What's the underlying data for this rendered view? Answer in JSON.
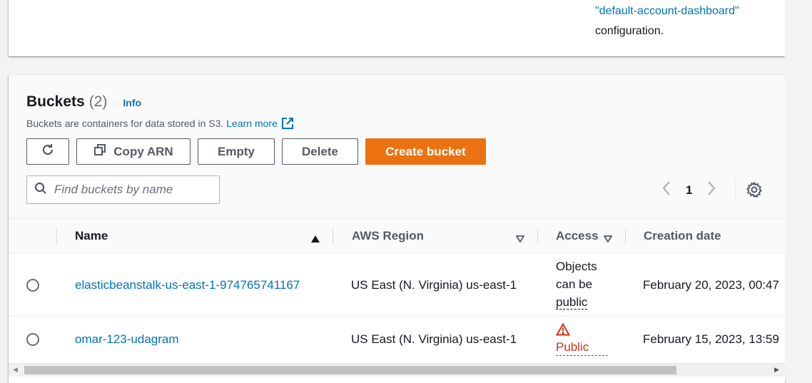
{
  "top_panel": {
    "config_name": "\"default-account-dashboard\"",
    "config_suffix": "configuration."
  },
  "buckets": {
    "title": "Buckets",
    "count": "(2)",
    "info_label": "Info",
    "description": "Buckets are containers for data stored in S3.",
    "learn_more": "Learn more",
    "toolbar": {
      "copy_arn_label": "Copy ARN",
      "empty_label": "Empty",
      "delete_label": "Delete",
      "create_label": "Create bucket"
    },
    "search": {
      "placeholder": "Find buckets by name",
      "value": ""
    },
    "pagination": {
      "current_page": "1"
    },
    "columns": {
      "name": "Name",
      "region": "AWS Region",
      "access": "Access",
      "created": "Creation date"
    },
    "rows": [
      {
        "name": "elasticbeanstalk-us-east-1-974765741167",
        "region": "US East (N. Virginia) us-east-1",
        "access_lines": [
          "Objects",
          "can be",
          "public"
        ],
        "created": "February 20, 2023, 00:47"
      },
      {
        "name": "omar-123-udagram",
        "region": "US East (N. Virginia) us-east-1",
        "access": "Public",
        "created": "February 15, 2023, 13:59"
      }
    ]
  },
  "colors": {
    "primary_button": "#ec7211",
    "link": "#0073bb",
    "warning": "#d13212",
    "text": "#16191f",
    "muted": "#545b64"
  },
  "icons": [
    "refresh-icon",
    "copy-icon",
    "external-link-icon",
    "search-icon",
    "chevron-left-icon",
    "chevron-right-icon",
    "settings-icon",
    "sort-ascending-icon",
    "sort-descending-icon",
    "warning-icon"
  ]
}
